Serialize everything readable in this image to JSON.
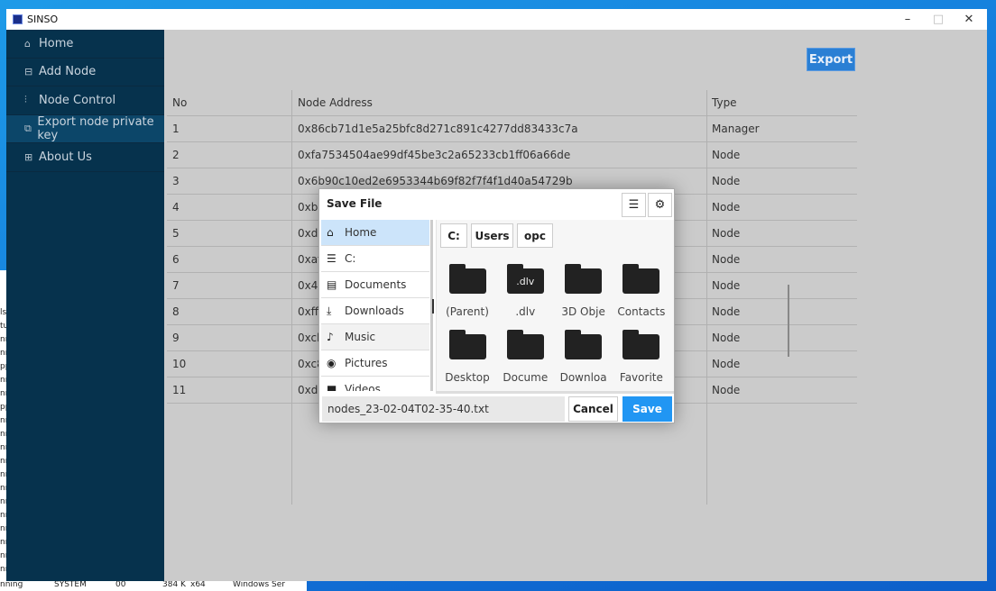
{
  "window": {
    "title": "SINSO",
    "minimize": "–",
    "maximize": "□",
    "close": "✕"
  },
  "sidebar": {
    "items": [
      {
        "label": "Home",
        "icon": "home-icon",
        "glyph": "⌂"
      },
      {
        "label": "Add Node",
        "icon": "add-node-icon",
        "glyph": "⊟"
      },
      {
        "label": "Node Control",
        "icon": "sliders-icon",
        "glyph": "⫶"
      },
      {
        "label": "Export node private key",
        "icon": "export-icon",
        "glyph": "⧉",
        "active": true
      },
      {
        "label": "About Us",
        "icon": "about-icon",
        "glyph": "⊞"
      }
    ]
  },
  "main": {
    "export_label": "Export",
    "table": {
      "headers": [
        "No",
        "Node Address",
        "Type"
      ],
      "rows": [
        [
          "1",
          "0x86cb71d1e5a25bfc8d271c891c4277dd83433c7a",
          "Manager"
        ],
        [
          "2",
          "0xfa7534504ae99df45be3c2a65233cb1ff06a66de",
          "Node"
        ],
        [
          "3",
          "0x6b90c10ed2e6953344b69f82f7f4f1d40a54729b",
          "Node"
        ],
        [
          "4",
          "0xb6",
          "Node"
        ],
        [
          "5",
          "0xda",
          "Node"
        ],
        [
          "6",
          "0xaf",
          "Node"
        ],
        [
          "7",
          "0x4b",
          "Node"
        ],
        [
          "8",
          "0xff",
          "Node"
        ],
        [
          "9",
          "0xcb",
          "Node"
        ],
        [
          "10",
          "0xc8",
          "Node"
        ],
        [
          "11",
          "0xd8",
          "Node"
        ]
      ]
    }
  },
  "dialog": {
    "title": "Save File",
    "places": [
      {
        "label": "Home",
        "glyph": "⌂"
      },
      {
        "label": "C:",
        "glyph": "☰"
      },
      {
        "label": "Documents",
        "glyph": "▤"
      },
      {
        "label": "Downloads",
        "glyph": "⤓"
      },
      {
        "label": "Music",
        "glyph": "♪"
      },
      {
        "label": "Pictures",
        "glyph": "◉"
      },
      {
        "label": "Videos",
        "glyph": "■"
      }
    ],
    "breadcrumb": [
      "C:",
      "Users",
      "opc"
    ],
    "folders": [
      {
        "label": "(Parent)",
        "badge": ""
      },
      {
        "label": ".dlv",
        "badge": ".dlv"
      },
      {
        "label": "3D Obje",
        "badge": ""
      },
      {
        "label": "Contacts",
        "badge": ""
      },
      {
        "label": "Desktop",
        "badge": ""
      },
      {
        "label": "Docume",
        "badge": ""
      },
      {
        "label": "Downloa",
        "badge": ""
      },
      {
        "label": "Favorite",
        "badge": ""
      }
    ],
    "filename": "nodes_23-02-04T02-35-40.txt",
    "cancel_label": "Cancel",
    "save_label": "Save"
  },
  "background": {
    "taskbar_text": [
      "nning",
      "SYSTEM",
      "00",
      "384 K",
      "x64",
      "Windows Ser"
    ],
    "left_text": [
      "ls",
      "tu",
      "nn",
      "nn",
      "pp",
      "nn",
      "nn",
      "pp",
      "nn",
      "nn",
      "nn",
      "nn",
      "nn",
      "nn",
      "nn",
      "nn",
      "nn",
      "nn",
      "nn",
      "nn"
    ]
  },
  "colors": {
    "sidebar": "#06324d",
    "accent": "#2a7fd4",
    "save": "#2196f3",
    "selected": "#cce4fa"
  }
}
